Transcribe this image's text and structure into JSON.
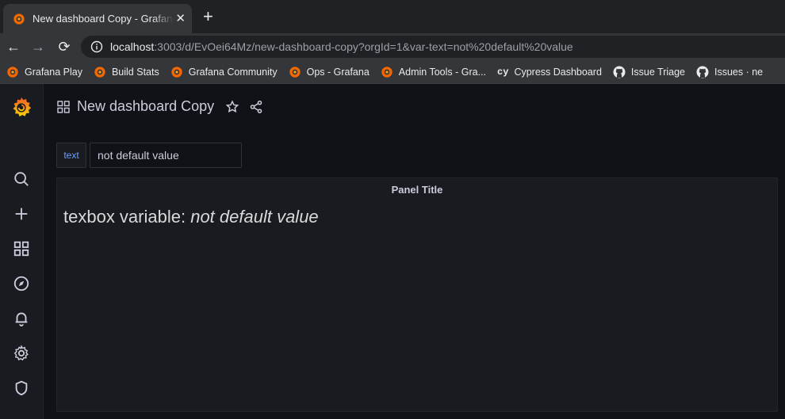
{
  "browser": {
    "tab_title": "New dashboard Copy - Grafana",
    "new_tab": "+",
    "url_host": "localhost",
    "url_rest": ":3003/d/EvOei64Mz/new-dashboard-copy?orgId=1&var-text=not%20default%20value"
  },
  "bookmarks": [
    {
      "label": "Grafana Play",
      "icon": "grafana-icon"
    },
    {
      "label": "Build Stats",
      "icon": "grafana-icon"
    },
    {
      "label": "Grafana Community",
      "icon": "grafana-icon"
    },
    {
      "label": "Ops - Grafana",
      "icon": "grafana-icon"
    },
    {
      "label": "Admin Tools - Gra...",
      "icon": "grafana-icon"
    },
    {
      "label": "Cypress Dashboard",
      "icon": "cypress-icon",
      "glyph": "cy"
    },
    {
      "label": "Issue Triage",
      "icon": "github-icon"
    },
    {
      "label": "Issues · ne",
      "icon": "github-icon"
    }
  ],
  "sidemenu": [
    "grafana-logo",
    "search-icon",
    "plus-icon",
    "dashboards-icon",
    "explore-icon",
    "alerting-icon",
    "settings-icon",
    "shield-icon"
  ],
  "dashboard": {
    "title": "New dashboard Copy"
  },
  "variable": {
    "label": "text",
    "value": "not default value"
  },
  "panel": {
    "title": "Panel Title",
    "text_prefix": "texbox variable: ",
    "text_value": "not default value"
  },
  "colors": {
    "grafana_orange": "#f46800",
    "variable_label_blue": "#6e9fff",
    "background": "#111217",
    "panel": "#181b1f"
  }
}
